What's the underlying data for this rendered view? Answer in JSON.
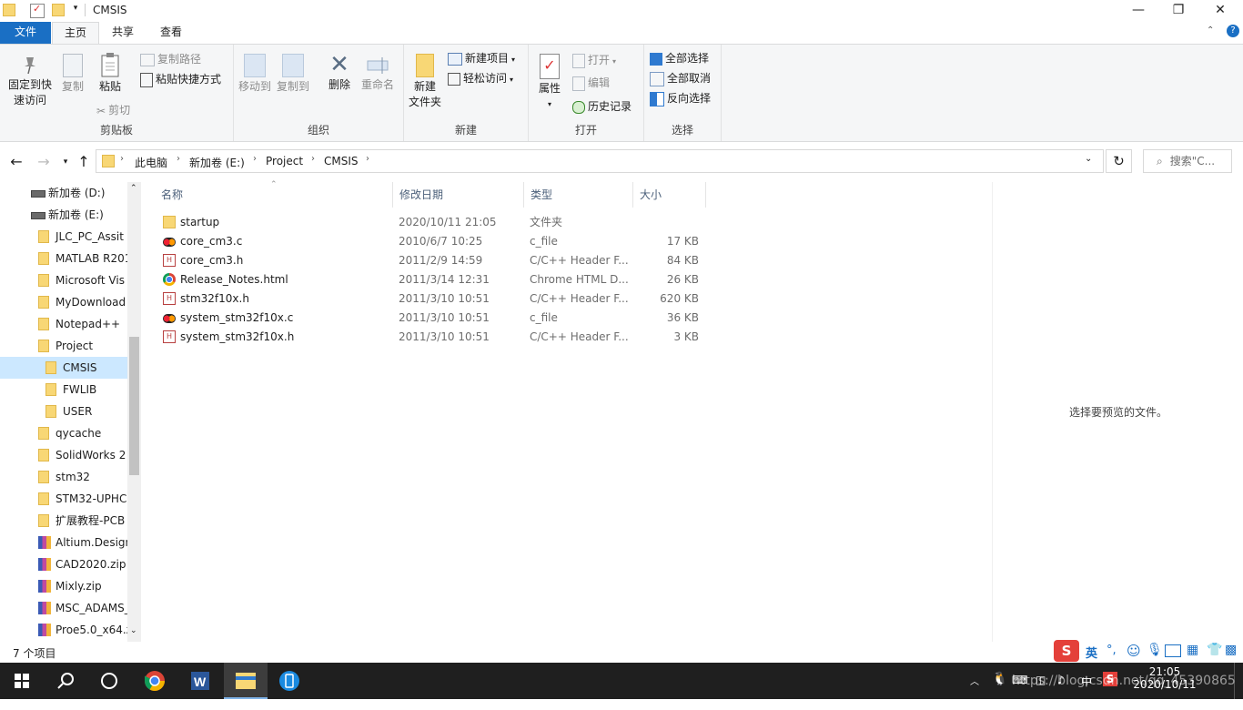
{
  "window": {
    "title": "CMSIS",
    "minimize": "—",
    "maximize": "❐",
    "close": "✕"
  },
  "ribbon_tabs": [
    "文件",
    "主页",
    "共享",
    "查看"
  ],
  "ribbon": {
    "clipboard": {
      "pin_label_1": "固定到快",
      "pin_label_2": "速访问",
      "copy": "复制",
      "paste": "粘贴",
      "copy_path": "复制路径",
      "paste_shortcut": "粘贴快捷方式",
      "cut": "剪切",
      "group": "剪贴板"
    },
    "organize": {
      "move_to": "移动到",
      "copy_to": "复制到",
      "delete": "删除",
      "rename": "重命名",
      "group": "组织"
    },
    "new": {
      "new_folder_1": "新建",
      "new_folder_2": "文件夹",
      "new_item": "新建项目",
      "easy_access": "轻松访问",
      "group": "新建"
    },
    "open": {
      "properties": "属性",
      "open": "打开",
      "edit": "编辑",
      "history": "历史记录",
      "group": "打开"
    },
    "select": {
      "select_all": "全部选择",
      "select_none": "全部取消",
      "invert": "反向选择",
      "group": "选择"
    }
  },
  "address": {
    "crumbs": [
      "此电脑",
      "新加卷 (E:)",
      "Project",
      "CMSIS"
    ],
    "search_placeholder": "搜索\"C..."
  },
  "tree": [
    {
      "label": "新加卷 (D:)",
      "icon": "drive-icon",
      "indent": 0
    },
    {
      "label": "新加卷 (E:)",
      "icon": "drive-icon",
      "indent": 0
    },
    {
      "label": "JLC_PC_Assit",
      "icon": "folder-icon",
      "indent": 1
    },
    {
      "label": "MATLAB R201",
      "icon": "folder-icon",
      "indent": 1
    },
    {
      "label": "Microsoft Vis",
      "icon": "folder-icon",
      "indent": 1
    },
    {
      "label": "MyDownload",
      "icon": "folder-icon",
      "indent": 1
    },
    {
      "label": "Notepad++",
      "icon": "folder-icon",
      "indent": 1
    },
    {
      "label": "Project",
      "icon": "folder-icon",
      "indent": 1
    },
    {
      "label": "CMSIS",
      "icon": "folder-icon",
      "indent": 2,
      "selected": true
    },
    {
      "label": "FWLIB",
      "icon": "folder-icon",
      "indent": 2
    },
    {
      "label": "USER",
      "icon": "folder-icon",
      "indent": 2
    },
    {
      "label": "qycache",
      "icon": "folder-icon",
      "indent": 1
    },
    {
      "label": "SolidWorks 2",
      "icon": "folder-icon",
      "indent": 1
    },
    {
      "label": "stm32",
      "icon": "folder-icon",
      "indent": 1
    },
    {
      "label": "STM32-UPHC",
      "icon": "folder-icon",
      "indent": 1
    },
    {
      "label": "扩展教程-PCB",
      "icon": "folder-icon",
      "indent": 1
    },
    {
      "label": "Altium.Design",
      "icon": "archive-icon",
      "indent": 1
    },
    {
      "label": "CAD2020.zip",
      "icon": "archive-icon",
      "indent": 1
    },
    {
      "label": "Mixly.zip",
      "icon": "archive-icon",
      "indent": 1
    },
    {
      "label": "MSC_ADAMS_",
      "icon": "archive-icon",
      "indent": 1
    },
    {
      "label": "Proe5.0_x64.z",
      "icon": "archive-icon",
      "indent": 1
    }
  ],
  "columns": [
    "名称",
    "修改日期",
    "类型",
    "大小"
  ],
  "files": [
    {
      "name": "startup",
      "date": "2020/10/11 21:05",
      "type": "文件夹",
      "size": "",
      "icon": "folder-icon"
    },
    {
      "name": "core_cm3.c",
      "date": "2010/6/7 10:25",
      "type": "c_file",
      "size": "17 KB",
      "icon": "c-file-icon"
    },
    {
      "name": "core_cm3.h",
      "date": "2011/2/9 14:59",
      "type": "C/C++ Header F...",
      "size": "84 KB",
      "icon": "header-file-icon"
    },
    {
      "name": "Release_Notes.html",
      "date": "2011/3/14 12:31",
      "type": "Chrome HTML D...",
      "size": "26 KB",
      "icon": "chrome-file-icon"
    },
    {
      "name": "stm32f10x.h",
      "date": "2011/3/10 10:51",
      "type": "C/C++ Header F...",
      "size": "620 KB",
      "icon": "header-file-icon"
    },
    {
      "name": "system_stm32f10x.c",
      "date": "2011/3/10 10:51",
      "type": "c_file",
      "size": "36 KB",
      "icon": "c-file-icon"
    },
    {
      "name": "system_stm32f10x.h",
      "date": "2011/3/10 10:51",
      "type": "C/C++ Header F...",
      "size": "3 KB",
      "icon": "header-file-icon"
    }
  ],
  "preview_message": "选择要预览的文件。",
  "status": "7 个项目",
  "ime_label": "英",
  "clock": {
    "time": "21:05",
    "date": "2020/10/11"
  },
  "watermark": "https://blog.csdn.net/qq_45390865"
}
